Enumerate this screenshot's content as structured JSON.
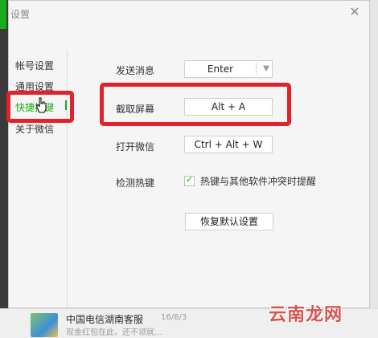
{
  "dialog": {
    "title": "设置",
    "close_icon": "close-icon"
  },
  "sidebar": {
    "items": [
      {
        "label": "帐号设置"
      },
      {
        "label": "通用设置"
      },
      {
        "label": "快捷按键",
        "active": true
      },
      {
        "label": "关于微信"
      }
    ]
  },
  "shortcuts": {
    "send_message": {
      "label": "发送消息",
      "value": "Enter"
    },
    "screenshot": {
      "label": "截取屏幕",
      "value": "Alt + A"
    },
    "open_wechat": {
      "label": "打开微信",
      "value": "Ctrl + Alt + W"
    },
    "detect_hotkeys": {
      "label": "检测热键",
      "checkbox_label": "热键与其他软件冲突时提醒",
      "checked": true
    },
    "restore_default_label": "恢复默认设置"
  },
  "background_app": {
    "chat_name": "中国电信湖南客服",
    "chat_time": "16/8/3",
    "chat_preview": "现金红包在此，还不领就..."
  },
  "watermark": "云南龙网",
  "colors": {
    "accent": "#1aad19",
    "highlight": "#e0232b"
  }
}
